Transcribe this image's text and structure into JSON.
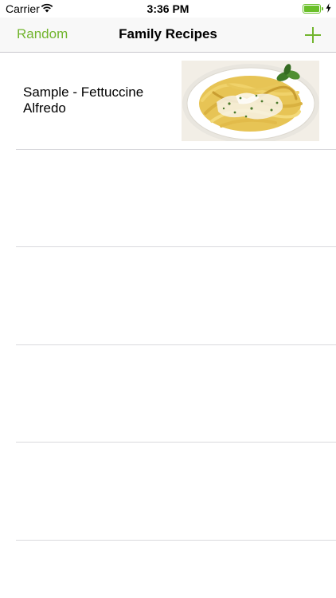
{
  "status_bar": {
    "carrier": "Carrier",
    "time": "3:36 PM",
    "battery_level": 1.0,
    "charging": true,
    "icons": [
      "wifi-icon",
      "battery-icon",
      "charging-bolt-icon"
    ]
  },
  "nav": {
    "left_button": "Random",
    "title": "Family Recipes",
    "add_icon": "plus-icon"
  },
  "colors": {
    "accent": "#72b52e",
    "separator": "#d9d9dd"
  },
  "recipes": [
    {
      "title": "Sample - Fettuccine Alfredo",
      "thumbnail": "fettuccine-alfredo-photo"
    }
  ],
  "empty_rows": 4
}
